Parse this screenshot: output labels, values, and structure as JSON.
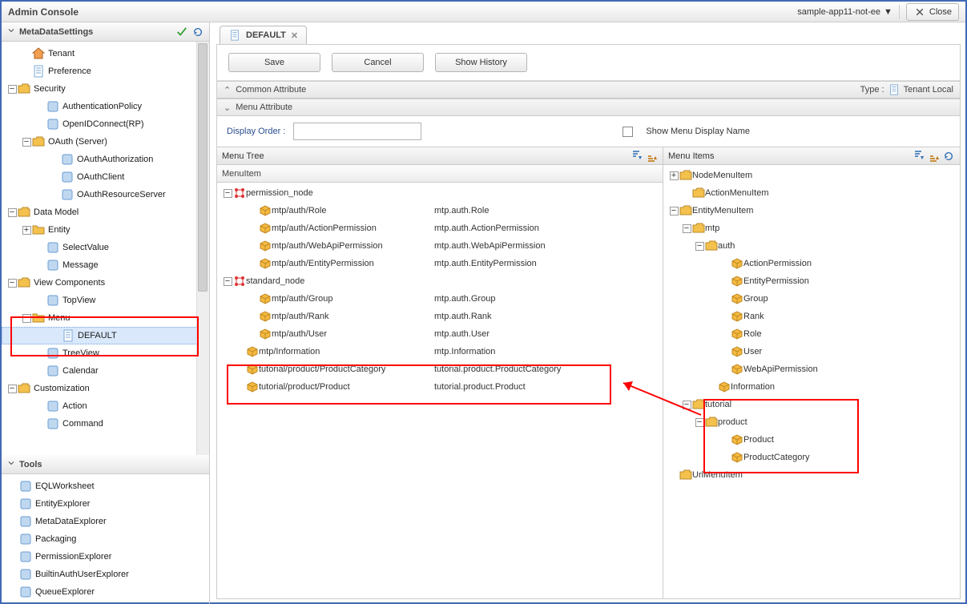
{
  "header": {
    "title": "Admin Console",
    "appName": "sample-app11-not-ee",
    "close": "Close"
  },
  "sidebar": {
    "metaHeader": "MetaDataSettings",
    "toolsHeader": "Tools",
    "tree": [
      {
        "label": "Tenant",
        "icon": "home",
        "indent": 1,
        "toggle": ""
      },
      {
        "label": "Preference",
        "icon": "page",
        "indent": 1,
        "toggle": ""
      },
      {
        "label": "Security",
        "icon": "folder-open",
        "indent": 0,
        "toggle": "−"
      },
      {
        "label": "AuthenticationPolicy",
        "icon": "auth",
        "indent": 2,
        "toggle": ""
      },
      {
        "label": "OpenIDConnect(RP)",
        "icon": "oidc",
        "indent": 2,
        "toggle": ""
      },
      {
        "label": "OAuth (Server)",
        "icon": "folder-open",
        "indent": 1,
        "toggle": "−"
      },
      {
        "label": "OAuthAuthorization",
        "icon": "oauth",
        "indent": 3,
        "toggle": ""
      },
      {
        "label": "OAuthClient",
        "icon": "oauth",
        "indent": 3,
        "toggle": ""
      },
      {
        "label": "OAuthResourceServer",
        "icon": "oauth",
        "indent": 3,
        "toggle": ""
      },
      {
        "label": "Data Model",
        "icon": "folder-open",
        "indent": 0,
        "toggle": "−"
      },
      {
        "label": "Entity",
        "icon": "folder-closed",
        "indent": 1,
        "toggle": "+"
      },
      {
        "label": "SelectValue",
        "icon": "select",
        "indent": 2,
        "toggle": ""
      },
      {
        "label": "Message",
        "icon": "message",
        "indent": 2,
        "toggle": ""
      },
      {
        "label": "View Components",
        "icon": "folder-open",
        "indent": 0,
        "toggle": "−"
      },
      {
        "label": "TopView",
        "icon": "view",
        "indent": 2,
        "toggle": ""
      },
      {
        "label": "Menu",
        "icon": "folder-closed",
        "indent": 1,
        "toggle": "−"
      },
      {
        "label": "DEFAULT",
        "icon": "page",
        "indent": 3,
        "toggle": "",
        "selected": true
      },
      {
        "label": "TreeView",
        "icon": "treeview",
        "indent": 2,
        "toggle": ""
      },
      {
        "label": "Calendar",
        "icon": "calendar",
        "indent": 2,
        "toggle": ""
      },
      {
        "label": "Customization",
        "icon": "folder-open",
        "indent": 0,
        "toggle": "−"
      },
      {
        "label": "Action",
        "icon": "action",
        "indent": 2,
        "toggle": ""
      },
      {
        "label": "Command",
        "icon": "command",
        "indent": 2,
        "toggle": ""
      }
    ],
    "tools": [
      {
        "label": "EQLWorksheet"
      },
      {
        "label": "EntityExplorer"
      },
      {
        "label": "MetaDataExplorer"
      },
      {
        "label": "Packaging"
      },
      {
        "label": "PermissionExplorer"
      },
      {
        "label": "BuiltinAuthUserExplorer"
      },
      {
        "label": "QueueExplorer"
      }
    ]
  },
  "tab": {
    "label": "DEFAULT"
  },
  "buttons": {
    "save": "Save",
    "cancel": "Cancel",
    "history": "Show History"
  },
  "sections": {
    "common": {
      "title": "Common Attribute",
      "typeLabel": "Type :",
      "typeValue": "Tenant Local"
    },
    "menu": {
      "title": "Menu Attribute"
    },
    "displayOrder": "Display Order :",
    "showMenu": "Show Menu Display Name"
  },
  "menuTree": {
    "header": "Menu Tree",
    "colHeader": "MenuItem",
    "rows": [
      {
        "t": "−",
        "i": "node",
        "c1": "permission_node",
        "c2": "",
        "ind": 0
      },
      {
        "t": "",
        "i": "box",
        "c1": "mtp/auth/Role",
        "c2": "mtp.auth.Role",
        "ind": 2
      },
      {
        "t": "",
        "i": "box",
        "c1": "mtp/auth/ActionPermission",
        "c2": "mtp.auth.ActionPermission",
        "ind": 2
      },
      {
        "t": "",
        "i": "box",
        "c1": "mtp/auth/WebApiPermission",
        "c2": "mtp.auth.WebApiPermission",
        "ind": 2
      },
      {
        "t": "",
        "i": "box",
        "c1": "mtp/auth/EntityPermission",
        "c2": "mtp.auth.EntityPermission",
        "ind": 2
      },
      {
        "t": "−",
        "i": "node",
        "c1": "standard_node",
        "c2": "",
        "ind": 0
      },
      {
        "t": "",
        "i": "box",
        "c1": "mtp/auth/Group",
        "c2": "mtp.auth.Group",
        "ind": 2
      },
      {
        "t": "",
        "i": "box",
        "c1": "mtp/auth/Rank",
        "c2": "mtp.auth.Rank",
        "ind": 2
      },
      {
        "t": "",
        "i": "box",
        "c1": "mtp/auth/User",
        "c2": "mtp.auth.User",
        "ind": 2
      },
      {
        "t": "",
        "i": "box",
        "c1": "mtp/Information",
        "c2": "mtp.Information",
        "ind": 1
      },
      {
        "t": "",
        "i": "box",
        "c1": "tutorial/product/ProductCategory",
        "c2": "tutorial.product.ProductCategory",
        "ind": 1
      },
      {
        "t": "",
        "i": "box",
        "c1": "tutorial/product/Product",
        "c2": "tutorial.product.Product",
        "ind": 1
      }
    ]
  },
  "menuItems": {
    "header": "Menu Items",
    "rows": [
      {
        "t": "+",
        "i": "folder",
        "c1": "NodeMenuItem",
        "ind": 0
      },
      {
        "t": "",
        "i": "folder",
        "c1": "ActionMenuItem",
        "ind": 1
      },
      {
        "t": "−",
        "i": "folder",
        "c1": "EntityMenuItem",
        "ind": 0
      },
      {
        "t": "−",
        "i": "folder",
        "c1": "mtp",
        "ind": 1
      },
      {
        "t": "−",
        "i": "folder",
        "c1": "auth",
        "ind": 2
      },
      {
        "t": "",
        "i": "box",
        "c1": "ActionPermission",
        "ind": 4
      },
      {
        "t": "",
        "i": "box",
        "c1": "EntityPermission",
        "ind": 4
      },
      {
        "t": "",
        "i": "box",
        "c1": "Group",
        "ind": 4
      },
      {
        "t": "",
        "i": "box",
        "c1": "Rank",
        "ind": 4
      },
      {
        "t": "",
        "i": "box",
        "c1": "Role",
        "ind": 4
      },
      {
        "t": "",
        "i": "box",
        "c1": "User",
        "ind": 4
      },
      {
        "t": "",
        "i": "box",
        "c1": "WebApiPermission",
        "ind": 4
      },
      {
        "t": "",
        "i": "box",
        "c1": "Information",
        "ind": 3
      },
      {
        "t": "−",
        "i": "folder",
        "c1": "tutorial",
        "ind": 1
      },
      {
        "t": "−",
        "i": "folder",
        "c1": "product",
        "ind": 2
      },
      {
        "t": "",
        "i": "box",
        "c1": "Product",
        "ind": 4
      },
      {
        "t": "",
        "i": "box",
        "c1": "ProductCategory",
        "ind": 4
      },
      {
        "t": "",
        "i": "folder",
        "c1": "UrlMenuItem",
        "ind": 0
      }
    ]
  }
}
